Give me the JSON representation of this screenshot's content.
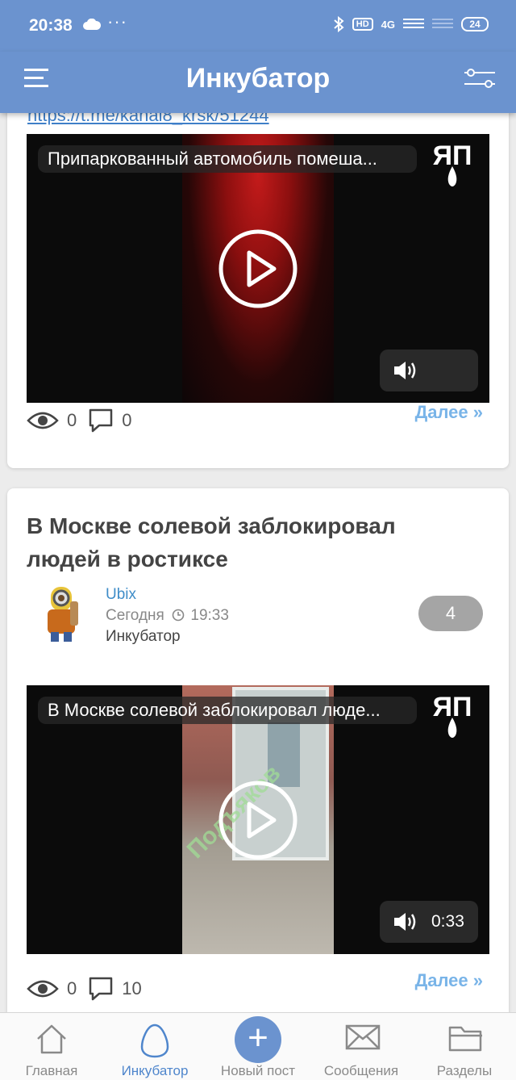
{
  "status_bar": {
    "time": "20:38",
    "dots": "···",
    "hd": "HD",
    "network": "4G",
    "battery": "24"
  },
  "app_bar": {
    "title": "Инкубатор"
  },
  "posts": [
    {
      "link": "https://t.me/kanal8_krsk/51244",
      "video": {
        "title": "Припаркованный автомобиль помеша...",
        "duration": ""
      },
      "views": "0",
      "comments": "0",
      "more": "Далее »"
    },
    {
      "title": "В Москве солевой заблокировал людей в ростиксе",
      "author": "Ubix",
      "date": "Сегодня",
      "time": "19:33",
      "category": "Инкубатор",
      "rating": "4",
      "video": {
        "title": "В Москве солевой заблокировал люде...",
        "duration": "0:33",
        "watermark": "Подъяков"
      },
      "views": "0",
      "comments": "10",
      "more": "Далее »"
    }
  ],
  "bottom_nav": [
    {
      "label": "Главная",
      "icon": "home-icon"
    },
    {
      "label": "Инкубатор",
      "icon": "egg-icon",
      "active": true
    },
    {
      "label": "Новый пост",
      "icon": "plus-icon"
    },
    {
      "label": "Сообщения",
      "icon": "envelope-icon"
    },
    {
      "label": "Разделы",
      "icon": "folder-icon"
    }
  ],
  "colors": {
    "accent": "#6b93cf",
    "link": "#3f7fc8",
    "more": "#79b4e8"
  }
}
